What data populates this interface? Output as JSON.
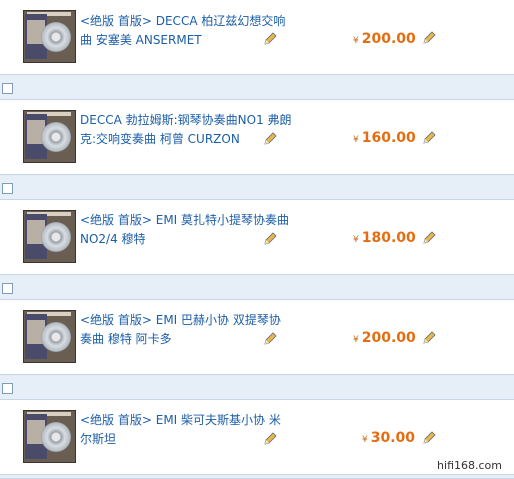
{
  "items": [
    {
      "title": "<绝版 首版> DECCA 柏辽兹幻想交响曲 安塞美 ANSERMET",
      "price": "200.00"
    },
    {
      "title": "DECCA 勃拉姆斯:钢琴协奏曲NO1 弗朗克:交响变奏曲 柯曾 CURZON",
      "price": "160.00"
    },
    {
      "title": "<绝版 首版> EMI 莫扎特小提琴协奏曲NO2/4 穆特",
      "price": "180.00"
    },
    {
      "title": "<绝版 首版> EMI 巴赫小协 双提琴协奏曲 穆特 阿卡多",
      "price": "200.00"
    },
    {
      "title": "<绝版 首版> EMI 柴可夫斯基小协 米尔斯坦",
      "price": "30.00"
    }
  ],
  "currency_symbol": "¥",
  "watermark": "hifi168.com",
  "colors": {
    "link": "#1c5ea8",
    "price": "#e46d11",
    "separator": "#e6eef8"
  },
  "icons": {
    "edit": "pencil-icon"
  }
}
